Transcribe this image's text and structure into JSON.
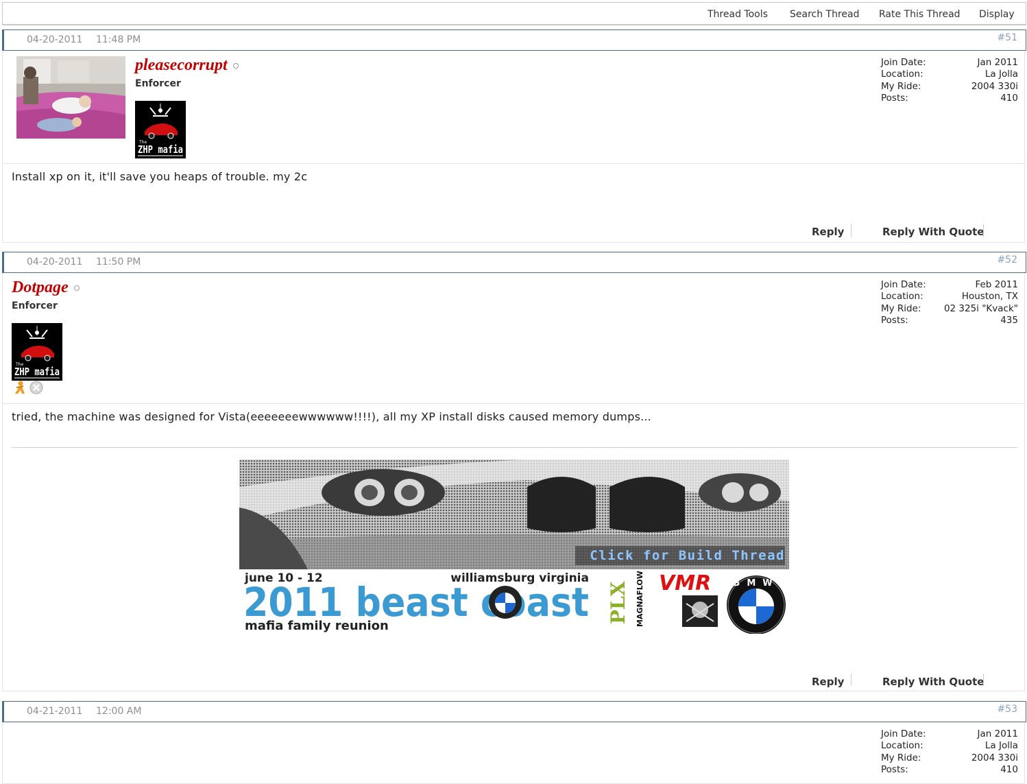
{
  "toolbar": {
    "thread_tools": "Thread Tools",
    "search_thread": "Search Thread",
    "rate_thread": "Rate This Thread",
    "display": "Display"
  },
  "stat_labels": {
    "join": "Join Date:",
    "location": "Location:",
    "ride": "My Ride:",
    "posts": "Posts:"
  },
  "posts": [
    {
      "date": "04-20-2011",
      "time": "11:48 PM",
      "number": "#51",
      "username": "pleasecorrupt",
      "title": "Enforcer",
      "join": "Jan 2011",
      "location": "La Jolla",
      "ride": "2004 330i",
      "count": "410",
      "text": "Install xp on it, it'll save you heaps of trouble. my 2c"
    },
    {
      "date": "04-20-2011",
      "time": "11:50 PM",
      "number": "#52",
      "username": "Dotpage",
      "title": "Enforcer",
      "join": "Feb 2011",
      "location": "Houston, TX",
      "ride": "02 325i \"Kvack\"",
      "count": "435",
      "text": "tried, the machine was designed for Vista(eeeeeeewwwwww!!!!), all my XP install disks caused memory dumps..."
    },
    {
      "date": "04-21-2011",
      "time": "12:00 AM",
      "number": "#53",
      "join": "Jan 2011",
      "location": "La Jolla",
      "ride": "2004 330i",
      "count": "410"
    }
  ],
  "actions": {
    "reply": "Reply",
    "reply_quote": "Reply With Quote"
  },
  "mafia_logo": {
    "the": "The",
    "text": "ZHP mafia"
  },
  "banner": {
    "cta": "Click for Build Thread",
    "dates": "june 10 - 12",
    "place": "williamsburg virginia",
    "event": "2011 beast coast",
    "sub": "mafia family reunion",
    "sponsor1": "PLX",
    "sponsor2": "MAGNAFLOW",
    "sponsor3": "VMR",
    "bmw": "BMW"
  },
  "colors": {
    "username": "#c00000",
    "header_border": "#4a6d8c",
    "postnum": "#8aa3bd"
  }
}
